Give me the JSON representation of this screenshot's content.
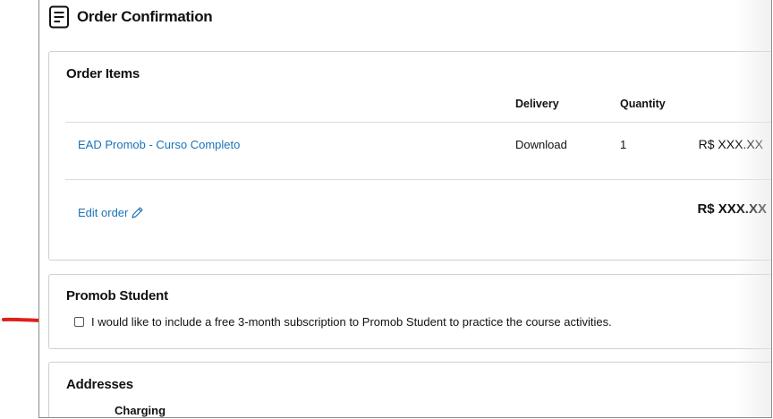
{
  "page": {
    "title": "Order Confirmation",
    "icon": "document-icon"
  },
  "order_items": {
    "title": "Order Items",
    "columns": [
      "Delivery",
      "Quantity"
    ],
    "rows": [
      {
        "name": "EAD Promob - Curso Completo",
        "delivery": "Download",
        "quantity": "1",
        "price": "R$ XXX.XX"
      }
    ],
    "edit_label": "Edit order",
    "edit_icon": "pencil-icon",
    "total": "R$ XXX.XX"
  },
  "promob_student": {
    "title": "Promob Student",
    "checkbox_label": "I would like to include a free 3-month subscription to Promob Student to practice the course activities.",
    "checked": false
  },
  "addresses": {
    "title": "Addresses",
    "charging_label": "Charging"
  },
  "colors": {
    "link": "#1a73b8",
    "annotation_arrow": "#e0201b",
    "card_border": "#cfcfcf"
  }
}
